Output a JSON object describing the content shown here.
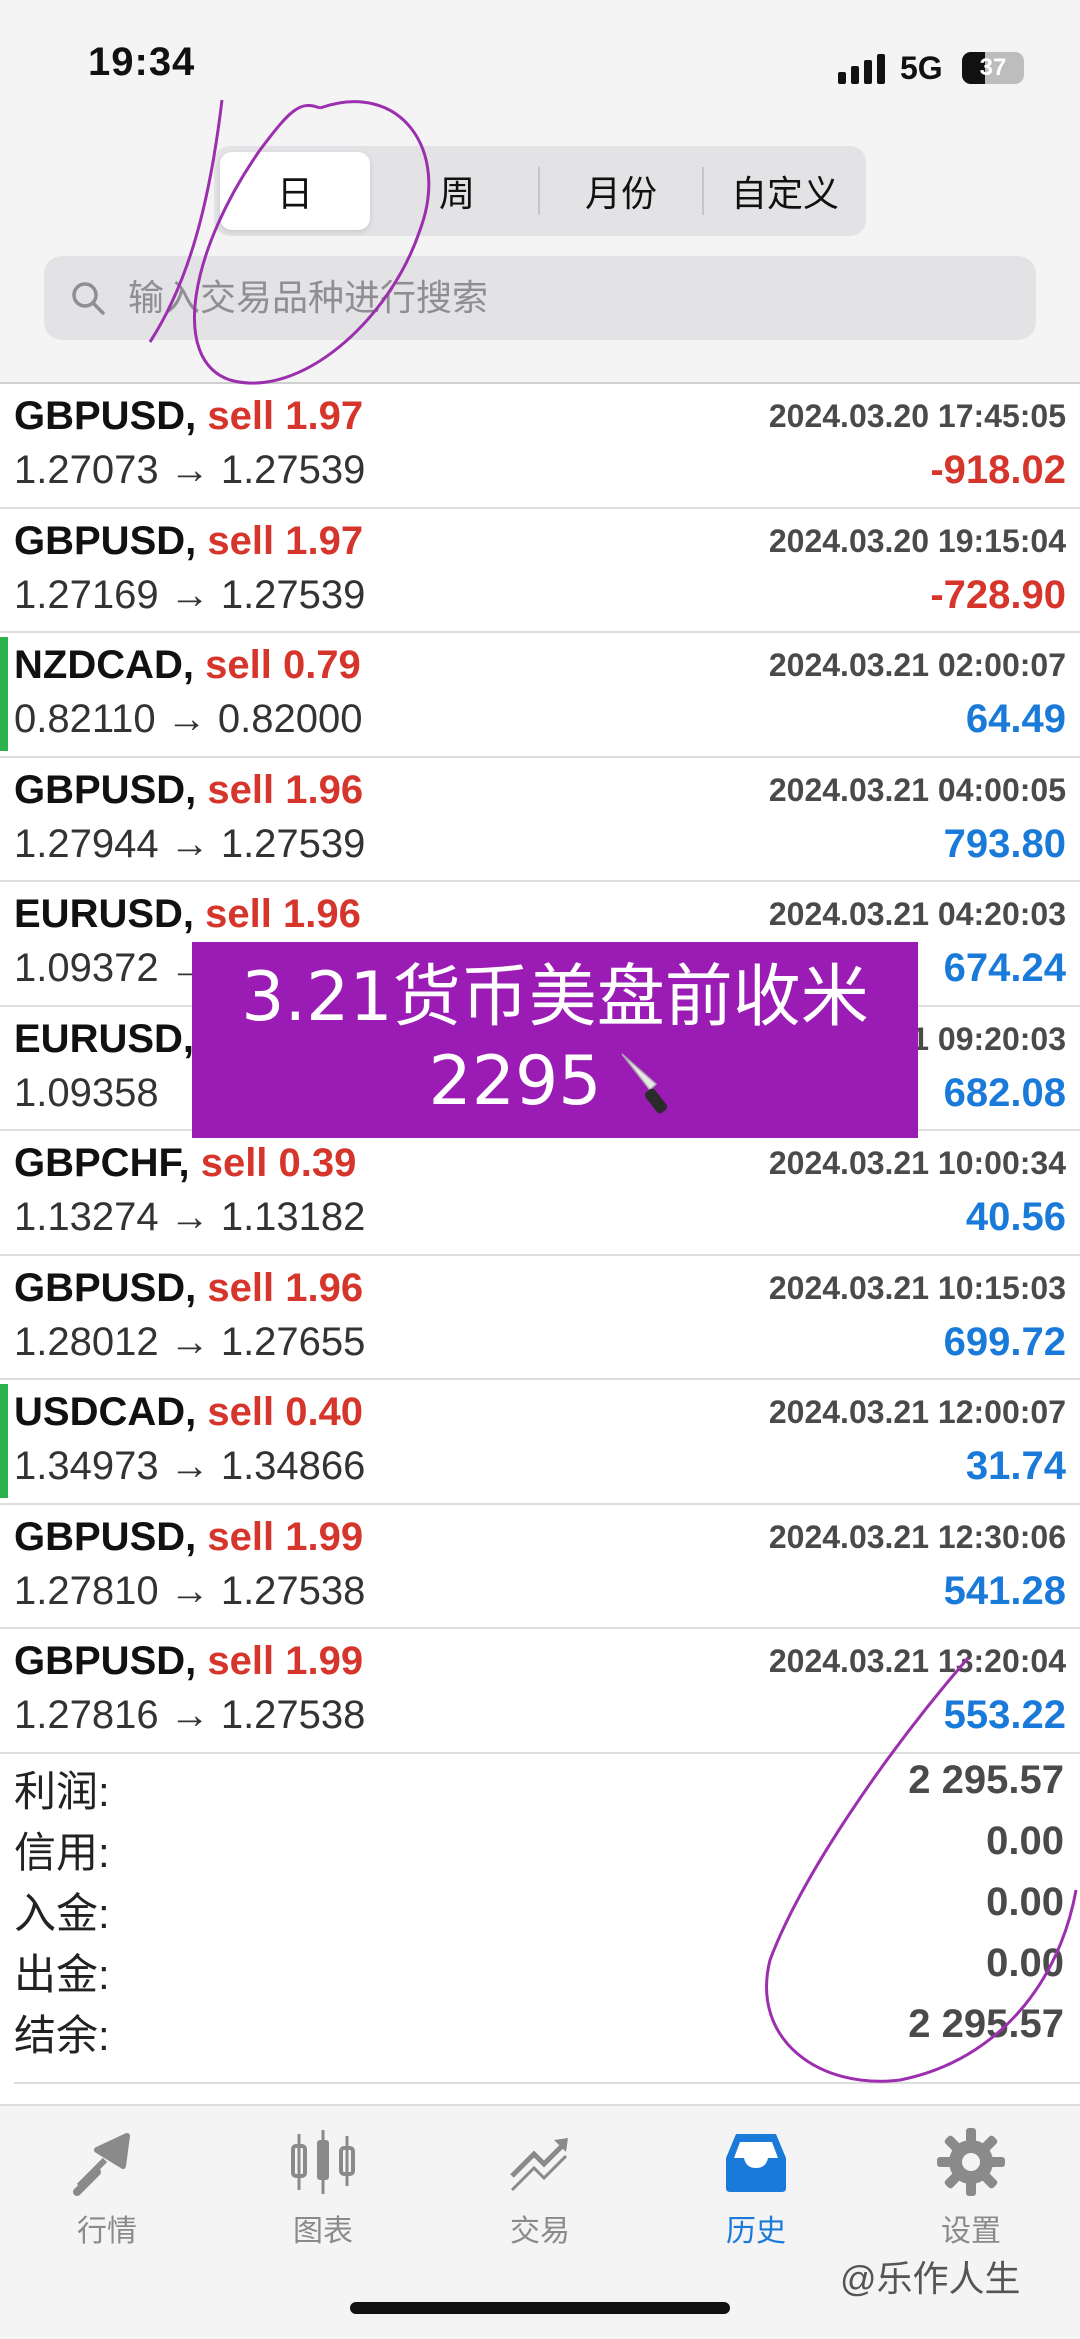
{
  "status_bar": {
    "time": "19:34",
    "network": "5G",
    "battery": "37",
    "battery_level": 0.37
  },
  "segment": {
    "tabs": [
      "日",
      "周",
      "月份",
      "自定义"
    ],
    "active": "日"
  },
  "search": {
    "placeholder": "输入交易品种进行搜索"
  },
  "deals": [
    {
      "symbol": "GBPUSD,",
      "side": "sell 1.97",
      "time": "2024.03.20 17:45:05",
      "prices": "1.27073 → 1.27539",
      "profit": "-918.02",
      "sign": "neg",
      "marked": false
    },
    {
      "symbol": "GBPUSD,",
      "side": "sell 1.97",
      "time": "2024.03.20 19:15:04",
      "prices": "1.27169 → 1.27539",
      "profit": "-728.90",
      "sign": "neg",
      "marked": false
    },
    {
      "symbol": "NZDCAD,",
      "side": "sell 0.79",
      "time": "2024.03.21 02:00:07",
      "prices": "0.82110 → 0.82000",
      "profit": "64.49",
      "sign": "pos",
      "marked": true
    },
    {
      "symbol": "GBPUSD,",
      "side": "sell 1.96",
      "time": "2024.03.21 04:00:05",
      "prices": "1.27944 → 1.27539",
      "profit": "793.80",
      "sign": "pos",
      "marked": false
    },
    {
      "symbol": "EURUSD,",
      "side": "sell 1.96",
      "time": "2024.03.21 04:20:03",
      "prices": "1.09372 →",
      "profit": "674.24",
      "sign": "pos",
      "marked": false
    },
    {
      "symbol": "EURUSD,",
      "side": "s",
      "time": "1 09:20:03",
      "prices": "1.09358",
      "profit": "682.08",
      "sign": "pos",
      "marked": false
    },
    {
      "symbol": "GBPCHF,",
      "side": "sell 0.39",
      "time": "2024.03.21 10:00:34",
      "prices": "1.13274 → 1.13182",
      "profit": "40.56",
      "sign": "pos",
      "marked": false
    },
    {
      "symbol": "GBPUSD,",
      "side": "sell 1.96",
      "time": "2024.03.21 10:15:03",
      "prices": "1.28012 → 1.27655",
      "profit": "699.72",
      "sign": "pos",
      "marked": false
    },
    {
      "symbol": "USDCAD,",
      "side": "sell 0.40",
      "time": "2024.03.21 12:00:07",
      "prices": "1.34973 → 1.34866",
      "profit": "31.74",
      "sign": "pos",
      "marked": true
    },
    {
      "symbol": "GBPUSD,",
      "side": "sell 1.99",
      "time": "2024.03.21 12:30:06",
      "prices": "1.27810 → 1.27538",
      "profit": "541.28",
      "sign": "pos",
      "marked": false
    },
    {
      "symbol": "GBPUSD,",
      "side": "sell 1.99",
      "time": "2024.03.21 13:20:04",
      "prices": "1.27816 → 1.27538",
      "profit": "553.22",
      "sign": "pos",
      "marked": false
    }
  ],
  "summary": [
    {
      "label": "利润:",
      "value": "2 295.57"
    },
    {
      "label": "信用:",
      "value": "0.00"
    },
    {
      "label": "入金:",
      "value": "0.00"
    },
    {
      "label": "出金:",
      "value": "0.00"
    },
    {
      "label": "结余:",
      "value": "2 295.57"
    }
  ],
  "banner": {
    "line1": "3.21货币美盘前收米",
    "line2": "2295",
    "icon": "knife-icon"
  },
  "tabbar": {
    "items": [
      {
        "label": "行情",
        "icon": "quotes-icon"
      },
      {
        "label": "图表",
        "icon": "chart-icon"
      },
      {
        "label": "交易",
        "icon": "trade-icon"
      },
      {
        "label": "历史",
        "icon": "history-icon"
      },
      {
        "label": "设置",
        "icon": "gear-icon"
      }
    ],
    "active": "历史",
    "active_color": "#1a7ad9",
    "inactive_color": "#8a8a8a"
  },
  "watermark": "@乐作人生",
  "colors": {
    "loss": "#d6352c",
    "profit": "#1a7ad9",
    "banner": "#9b1cb5",
    "marker": "#2bb24c"
  }
}
